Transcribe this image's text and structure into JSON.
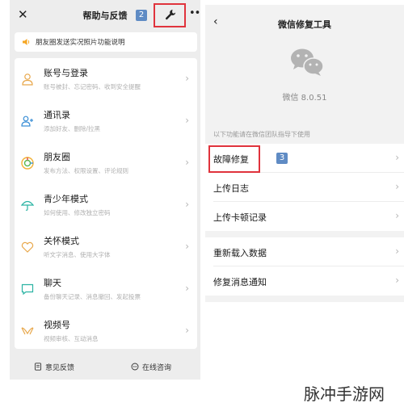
{
  "left": {
    "title": "帮助与反馈",
    "badge_number": "2",
    "notice": "朋友圈发送实况照片功能说明",
    "menu": [
      {
        "title": "账号与登录",
        "subtitle": "账号被封、忘记密码、收到安全提醒",
        "icon": "person-icon"
      },
      {
        "title": "通讯录",
        "subtitle": "添加好友、删除/拉黑",
        "icon": "contacts-icon"
      },
      {
        "title": "朋友圈",
        "subtitle": "发布方法、权限设置、评论规则",
        "icon": "moments-icon"
      },
      {
        "title": "青少年模式",
        "subtitle": "如何使用、修改独立密码",
        "icon": "umbrella-icon"
      },
      {
        "title": "关怀模式",
        "subtitle": "听文字消息、使用大字体",
        "icon": "heart-icon"
      },
      {
        "title": "聊天",
        "subtitle": "备份聊天记录、消息撤回、发起投票",
        "icon": "chat-icon"
      },
      {
        "title": "视频号",
        "subtitle": "视频审核、互动消息",
        "icon": "channels-icon"
      }
    ],
    "bottom": {
      "feedback": "意见反馈",
      "consult": "在线咨询"
    },
    "icons": {
      "close": "close-icon",
      "wrench": "wrench-icon",
      "more": "more-icon",
      "speaker": "speaker-icon"
    }
  },
  "right": {
    "title": "微信修复工具",
    "version": "微信 8.0.51",
    "hint": "以下功能请在微信团队指导下使用",
    "badge_number": "3",
    "tools": [
      "故障修复",
      "上传日志",
      "上传卡顿记录"
    ],
    "tools2": [
      "重新载入数据",
      "修复消息通知"
    ],
    "icons": {
      "back": "back-chevron-icon",
      "logo": "wechat-logo-icon"
    }
  },
  "watermark": "脉冲手游网",
  "colors": {
    "highlight": "#e0333c",
    "badge": "#5f8bc4",
    "panel_bg": "#ededed",
    "wechat_green": "#07c160"
  }
}
